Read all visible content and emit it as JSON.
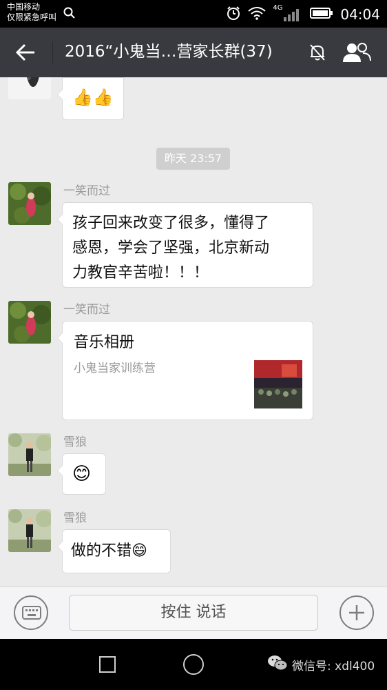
{
  "status_bar": {
    "carrier_line1": "中国移动",
    "carrier_line2": "仅限紧急呼叫",
    "network": "4G",
    "time": "04:04"
  },
  "header": {
    "title": "2016“小鬼当…营家长群(37)",
    "icons": [
      "back-arrow-icon",
      "mute-bell-icon",
      "group-members-icon"
    ]
  },
  "chat": {
    "timestamp": "昨天 23:57",
    "messages": [
      {
        "sender": "",
        "content": "👍👍"
      },
      {
        "sender": "一笑而过",
        "lines": [
          "孩子回来改变了很多，懂得了",
          "感恩，学会了坚强，北京新动",
          "力教官辛苦啦！！！"
        ]
      },
      {
        "sender": "一笑而过",
        "card_title": "音乐相册",
        "card_subtitle": "小鬼当家训练营"
      },
      {
        "sender": "雪狼",
        "content": "😊"
      },
      {
        "sender": "雪狼",
        "content": "做的不错😄"
      }
    ]
  },
  "input_bar": {
    "hold_to_talk": "按住 说话",
    "icons": [
      "keyboard-icon",
      "plus-icon"
    ]
  },
  "nav_bar": {
    "watermark": "微信号: xdl400",
    "icons": [
      "nav-back-icon",
      "nav-home-icon",
      "nav-recent-icon",
      "wechat-logo-icon"
    ]
  },
  "colors": {
    "title_bar": "#393a3f",
    "chat_background": "#ebebeb",
    "bubble": "#ffffff",
    "timestamp_badge": "#cfcfcf"
  }
}
